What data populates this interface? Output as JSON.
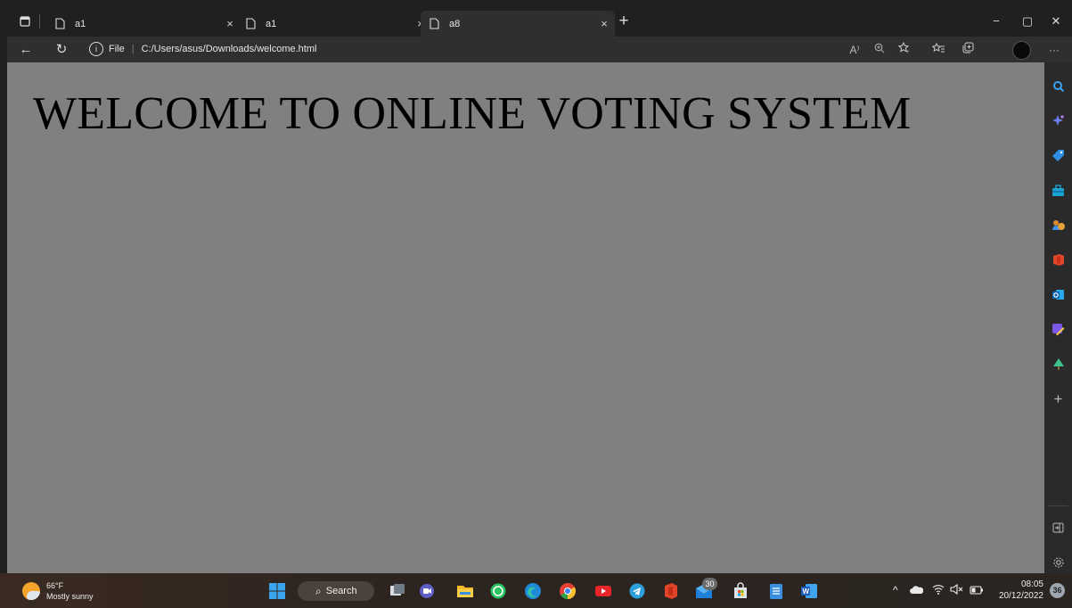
{
  "browser": {
    "tabs": [
      {
        "title": "a1",
        "close": "×"
      },
      {
        "title": "a1",
        "close": "×"
      },
      {
        "title": "a8",
        "close": "×"
      }
    ],
    "new_tab": "+",
    "window_controls": {
      "minimize": "−",
      "restore": "▢",
      "close": "✕"
    },
    "nav": {
      "back": "←",
      "refresh": "↻"
    },
    "address": {
      "info_glyph": "i",
      "scheme_label": "File",
      "separator": "|",
      "url": "C:/Users/asus/Downloads/welcome.html"
    },
    "toolbar_icons": [
      "read-aloud-icon",
      "zoom-icon",
      "favorite-add-icon",
      "favorites-icon",
      "collections-icon",
      "profile-avatar",
      "more-icon"
    ],
    "read_aloud_label": "A⁾",
    "more_label": "···"
  },
  "page": {
    "heading": "WELCOME TO ONLINE VOTING SYSTEM",
    "background": "#808080"
  },
  "sidebar": {
    "icons": [
      "search-icon",
      "discover-icon",
      "shopping-tag-icon",
      "tools-icon",
      "games-icon",
      "office-icon",
      "outlook-icon",
      "designer-icon",
      "tree-icon",
      "add-icon",
      "split-screen-icon",
      "settings-icon"
    ],
    "add_label": "+"
  },
  "taskbar": {
    "weather": {
      "temp": "66°F",
      "condition": "Mostly sunny"
    },
    "search_label": "Search",
    "apps": [
      "windows-start",
      "task-view",
      "teams-chat",
      "file-explorer",
      "whatsapp",
      "edge",
      "chrome",
      "youtube",
      "telegram",
      "office",
      "mail",
      "store",
      "notepad",
      "word"
    ],
    "mail_badge": "30",
    "tray": {
      "chevron": "^",
      "wifi": "wifi",
      "volume": "volume",
      "battery": "battery"
    },
    "time": "08:05",
    "date": "20/12/2022",
    "notifications": "36"
  }
}
